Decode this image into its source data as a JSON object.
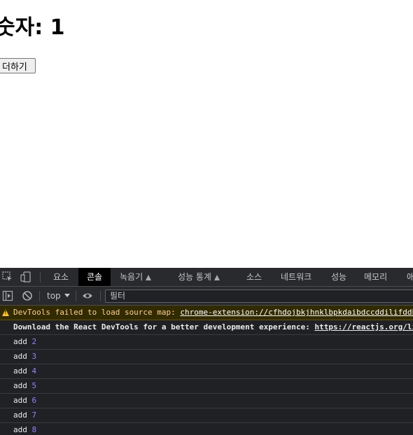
{
  "page": {
    "heading": "숫자: 1",
    "add_button_label": "더하기"
  },
  "devtools": {
    "tabs": [
      {
        "label": "요소",
        "active": false
      },
      {
        "label": "콘솔",
        "active": true
      },
      {
        "label": "녹음기",
        "active": false,
        "experimental": true
      },
      {
        "label": "성능 통계",
        "active": false,
        "experimental": true
      },
      {
        "label": "소스",
        "active": false
      },
      {
        "label": "네트워크",
        "active": false
      },
      {
        "label": "성능",
        "active": false
      },
      {
        "label": "메모리",
        "active": false
      },
      {
        "label": "애",
        "active": false
      }
    ],
    "toolbar": {
      "context": "top",
      "filter_placeholder": "필터"
    },
    "console": {
      "warning": {
        "text": "DevTools failed to load source map: ",
        "link": "chrome-extension://cfhdojbkjhnklbpkdaibdccddilifddb"
      },
      "info": {
        "text": "Download the React DevTools for a better development experience: ",
        "link": "https://reactjs.org/link/react-devtools"
      },
      "logs": [
        {
          "label": "add",
          "value": "2"
        },
        {
          "label": "add",
          "value": "3"
        },
        {
          "label": "add",
          "value": "4"
        },
        {
          "label": "add",
          "value": "5"
        },
        {
          "label": "add",
          "value": "6"
        },
        {
          "label": "add",
          "value": "7"
        },
        {
          "label": "add",
          "value": "8"
        }
      ]
    }
  },
  "colors": {
    "devtools_bg": "#202124",
    "warning_bg": "#332b00",
    "warning_text": "#ffd08a",
    "number": "#9980ff"
  }
}
